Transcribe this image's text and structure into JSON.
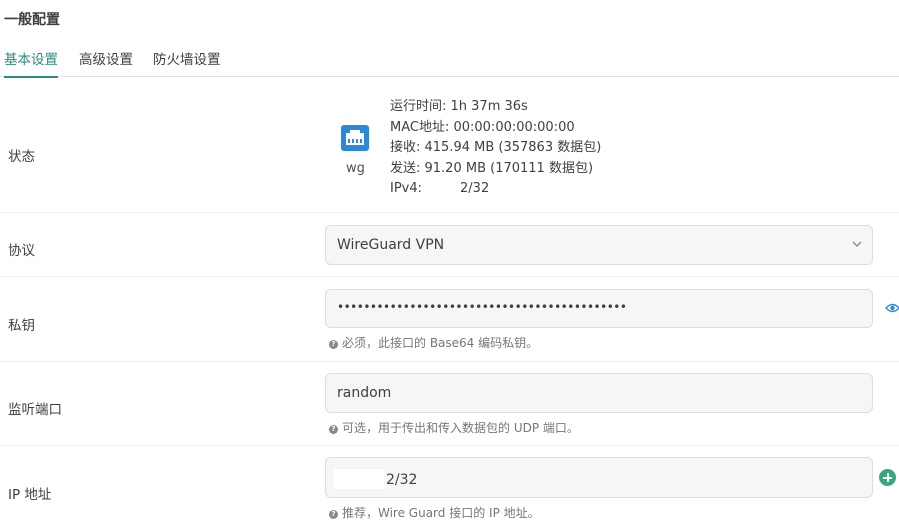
{
  "section_title": "一般配置",
  "tabs": [
    {
      "label": "基本设置",
      "active": true
    },
    {
      "label": "高级设置",
      "active": false
    },
    {
      "label": "防火墙设置",
      "active": false
    }
  ],
  "status": {
    "label": "状态",
    "interface_name": "wg",
    "icon": "network-port-icon",
    "lines": {
      "uptime": "运行时间: 1h 37m 36s",
      "mac": "MAC地址: 00:00:00:00:00:00",
      "rx": "接收: 415.94 MB (357863 数据包)",
      "tx": "发送: 91.20 MB (170111 数据包)",
      "ipv4_label": "IPv4:",
      "ipv4_value": "2/32"
    }
  },
  "protocol": {
    "label": "协议",
    "value": "WireGuard VPN"
  },
  "private_key": {
    "label": "私钥",
    "value": "••••••••••••••••••••••••••••••••••••••••••••",
    "hint": "必须，此接口的 Base64 编码私钥。"
  },
  "listen_port": {
    "label": "监听端口",
    "value": "random",
    "hint": "可选，用于传出和传入数据包的 UDP 端口。"
  },
  "ip_address": {
    "label": "IP 地址",
    "value": "2/32",
    "hint": "推荐，Wire Guard 接口的 IP 地址。"
  },
  "colors": {
    "accent": "#2e8b7f",
    "status_icon": "#2b8ad8",
    "add_button": "#38a87a"
  }
}
